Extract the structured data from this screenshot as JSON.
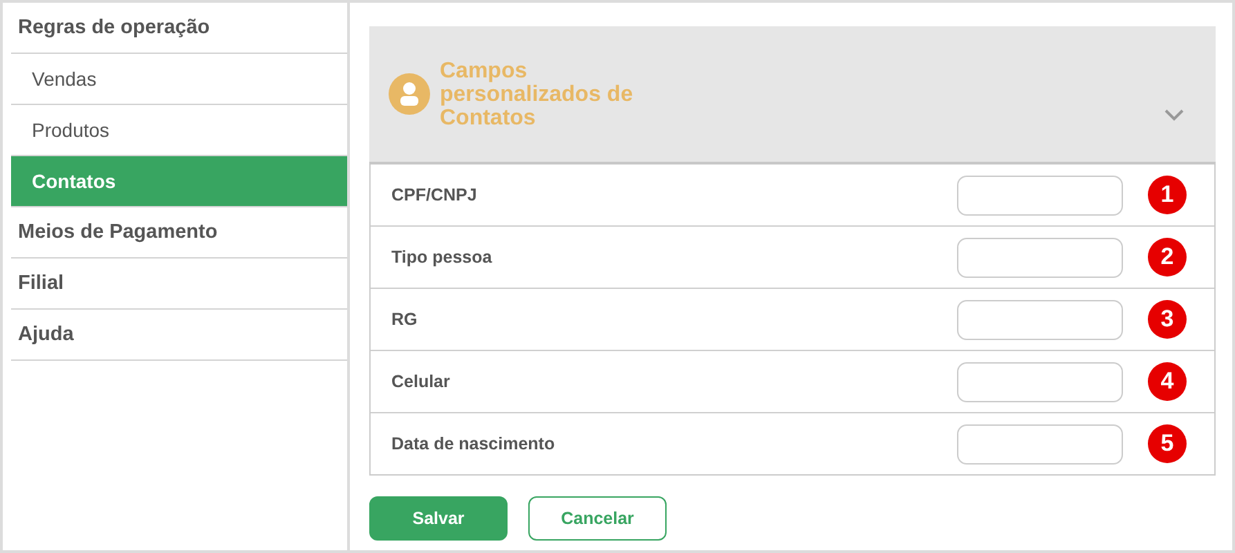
{
  "sidebar": {
    "items": [
      {
        "label": "Regras de operação",
        "selected": false,
        "children": [
          {
            "label": "Vendas",
            "selected": false
          },
          {
            "label": "Produtos",
            "selected": false
          },
          {
            "label": "Contatos",
            "selected": true
          }
        ]
      },
      {
        "label": "Meios de Pagamento",
        "selected": false
      },
      {
        "label": "Filial",
        "selected": false
      },
      {
        "label": "Ajuda",
        "selected": false
      }
    ]
  },
  "panel": {
    "title": "Campos personalizados de Contatos",
    "expanded": true,
    "fields": [
      {
        "label": "CPF/CNPJ",
        "badge": "1"
      },
      {
        "label": "Tipo pessoa",
        "badge": "2"
      },
      {
        "label": "RG",
        "badge": "3"
      },
      {
        "label": "Celular",
        "badge": "4"
      },
      {
        "label": "Data de nascimento",
        "badge": "5"
      }
    ]
  },
  "buttons": [
    {
      "label": "Salvar",
      "kind": "primary"
    },
    {
      "label": "Cancelar",
      "kind": "secondary"
    }
  ]
}
